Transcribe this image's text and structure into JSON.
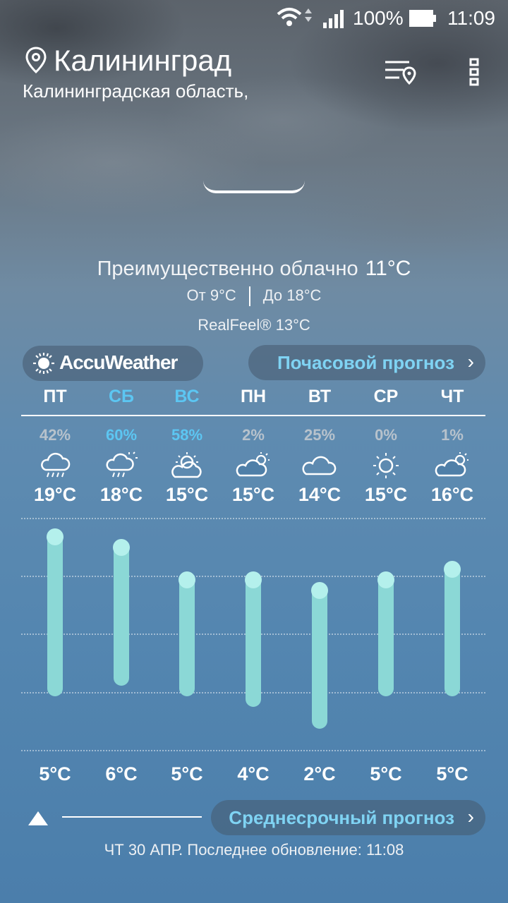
{
  "status_bar": {
    "battery": "100%",
    "time": "11:09",
    "icons": [
      "wifi-icon",
      "signal-icon",
      "battery-icon"
    ]
  },
  "location": {
    "city": "Калининград",
    "region": "Калининградская область,"
  },
  "current": {
    "condition": "Преимущественно облачно",
    "temperature": "11°C",
    "min": "От 9°C",
    "max": "До 18°C",
    "realfeel": "RealFeel® 13°C"
  },
  "buttons": {
    "accuweather": "AccuWeather",
    "hourly": "Почасовой прогноз",
    "midterm": "Среднесрочный прогноз",
    "chevron": "›"
  },
  "forecast": [
    {
      "day": "ПТ",
      "precip": "42%",
      "high": "19°C",
      "low": "5°C",
      "icon": "cloud-rain-icon",
      "highlight": false
    },
    {
      "day": "СБ",
      "precip": "60%",
      "high": "18°C",
      "low": "6°C",
      "icon": "cloud-sun-rain-icon",
      "highlight": true
    },
    {
      "day": "ВС",
      "precip": "58%",
      "high": "15°C",
      "low": "5°C",
      "icon": "sun-cloud-icon",
      "highlight": true
    },
    {
      "day": "ПН",
      "precip": "2%",
      "high": "15°C",
      "low": "4°C",
      "icon": "cloud-sun-icon",
      "highlight": false
    },
    {
      "day": "ВТ",
      "precip": "25%",
      "high": "14°C",
      "low": "2°C",
      "icon": "cloud-icon",
      "highlight": false
    },
    {
      "day": "СР",
      "precip": "0%",
      "high": "15°C",
      "low": "5°C",
      "icon": "sun-icon",
      "highlight": false
    },
    {
      "day": "ЧТ",
      "precip": "1%",
      "high": "16°C",
      "low": "5°C",
      "icon": "cloud-sun-icon",
      "highlight": false
    }
  ],
  "forecast_values": {
    "highs": [
      19,
      18,
      15,
      15,
      14,
      15,
      16
    ],
    "lows": [
      5,
      6,
      5,
      4,
      2,
      5,
      5
    ]
  },
  "colors": {
    "highlight_day": "#5cc6f2",
    "link": "#7fd3f3",
    "bar": "#8bd8d6"
  },
  "footer": {
    "updated": "ЧТ 30 АПР. Последнее обновление: 11:08"
  }
}
